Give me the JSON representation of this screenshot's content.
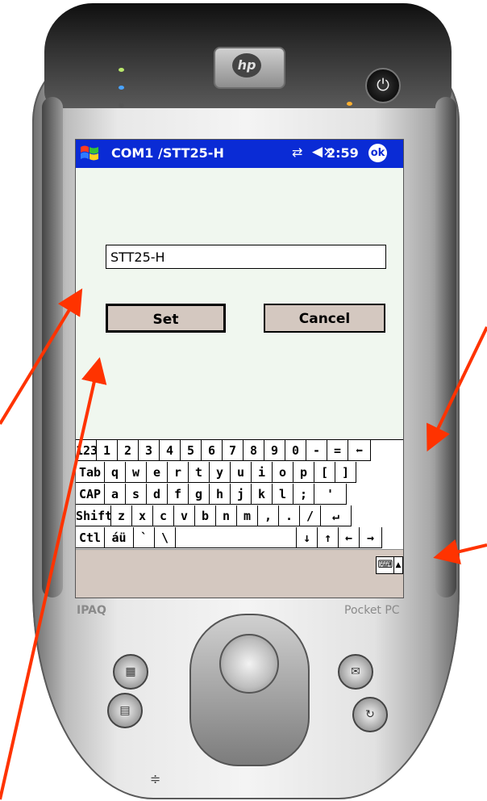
{
  "screen": {
    "title": "COM1 /STT25-H",
    "clock": "2:59",
    "ok_label": "ok",
    "input_value": "STT25-H",
    "set_label": "Set",
    "cancel_label": "Cancel"
  },
  "keyboard": {
    "rows": [
      [
        "123",
        "1",
        "2",
        "3",
        "4",
        "5",
        "6",
        "7",
        "8",
        "9",
        "0",
        "-",
        "=",
        "⬅"
      ],
      [
        "Tab",
        "q",
        "w",
        "e",
        "r",
        "t",
        "y",
        "u",
        "i",
        "o",
        "p",
        "[",
        "]"
      ],
      [
        "CAP",
        "a",
        "s",
        "d",
        "f",
        "g",
        "h",
        "j",
        "k",
        "l",
        ";",
        "'"
      ],
      [
        "Shift",
        "z",
        "x",
        "c",
        "v",
        "b",
        "n",
        "m",
        ",",
        ".",
        "/",
        "↵"
      ],
      [
        "Ctl",
        "áü",
        "`",
        "\\",
        "",
        "↓",
        "↑",
        "←",
        "→"
      ]
    ]
  },
  "device": {
    "brand_left": "IPAQ",
    "brand_right": "Pocket PC"
  },
  "colors": {
    "title_bar": "#0a2bd5",
    "screen_bg": "#f0f7ef",
    "button_face": "#d4c8c0",
    "arrow": "#ff3300"
  },
  "icons": {
    "start": "windows-flag-icon",
    "connection": "connectivity-icon",
    "volume": "speaker-muted-icon",
    "keyboard": "keyboard-icon"
  }
}
